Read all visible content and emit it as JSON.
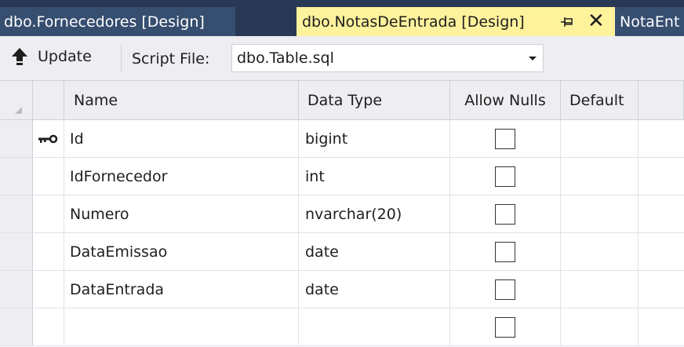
{
  "tabs": [
    {
      "label": "dbo.Fornecedores [Design]",
      "active": false
    },
    {
      "label": "dbo.NotasDeEntrada [Design]",
      "active": true
    },
    {
      "label": "NotaEnt",
      "active": false
    }
  ],
  "toolbar": {
    "update_label": "Update",
    "script_file_label": "Script File:",
    "script_file_value": "dbo.Table.sql"
  },
  "grid": {
    "columns": [
      "Name",
      "Data Type",
      "Allow Nulls",
      "Default"
    ],
    "rows": [
      {
        "name": "Id",
        "type": "bigint",
        "allow_nulls": false,
        "primary_key": true
      },
      {
        "name": "IdFornecedor",
        "type": "int",
        "allow_nulls": false
      },
      {
        "name": "Numero",
        "type": "nvarchar(20)",
        "allow_nulls": false
      },
      {
        "name": "DataEmissao",
        "type": "date",
        "allow_nulls": false
      },
      {
        "name": "DataEntrada",
        "type": "date",
        "allow_nulls": false
      },
      {
        "name": "",
        "type": "",
        "allow_nulls": false
      }
    ]
  },
  "icons": {
    "update": "up-arrow-icon",
    "pin": "pin-icon",
    "close": "close-icon",
    "primary_key": "key-icon"
  },
  "colors": {
    "tab_strip": "#293955",
    "active_tab": "#fff29d",
    "toolbar": "#eeeef2"
  }
}
